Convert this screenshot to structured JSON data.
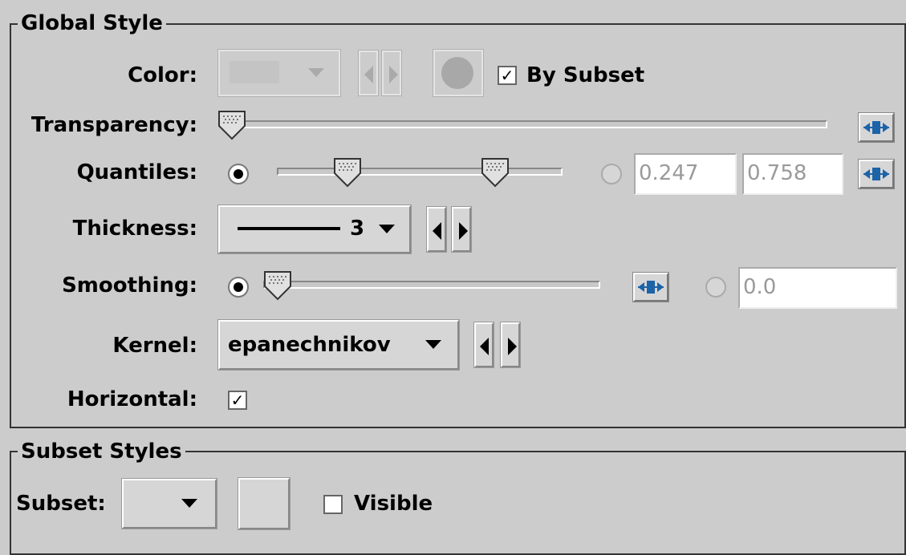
{
  "global_style": {
    "title": "Global Style",
    "color": {
      "label": "Color:",
      "swatch": "#bdbdbd",
      "by_subset_label": "By Subset",
      "by_subset_checked": true
    },
    "transparency": {
      "label": "Transparency:",
      "value": 0.0
    },
    "quantiles": {
      "label": "Quantiles:",
      "low": 0.247,
      "high": 0.758,
      "low_text": "0.247",
      "high_text": "0.758",
      "slider_selected": true
    },
    "thickness": {
      "label": "Thickness:",
      "value": "3"
    },
    "smoothing": {
      "label": "Smoothing:",
      "value": 0.0,
      "value_text": "0.0",
      "slider_selected": true
    },
    "kernel": {
      "label": "Kernel:",
      "value": "epanechnikov"
    },
    "horizontal": {
      "label": "Horizontal:",
      "checked": true
    }
  },
  "subset_styles": {
    "title": "Subset Styles",
    "subset_label": "Subset:",
    "visible_label": "Visible",
    "visible_checked": false
  },
  "icons": {
    "map_button": "colormap-range-icon",
    "stepper": "prev-next-icon",
    "dropdown": "chevron-down-icon"
  },
  "colors": {
    "background": "#cccccc",
    "accent_blue": "#1c63a8"
  }
}
